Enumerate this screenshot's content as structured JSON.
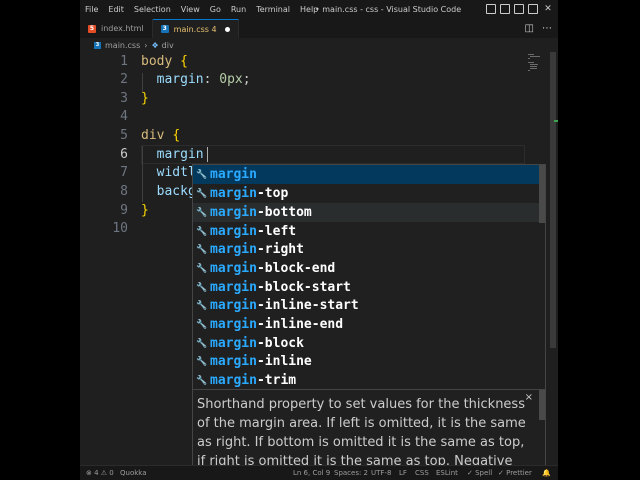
{
  "titlebar": {
    "menu": [
      "File",
      "Edit",
      "Selection",
      "View",
      "Go",
      "Run",
      "Terminal",
      "Help"
    ],
    "title": "• main.css - css - Visual Studio Code",
    "close_glyph": "✕"
  },
  "tabs": [
    {
      "label": "index.html",
      "type": "html"
    },
    {
      "label": "main.css 4",
      "type": "css",
      "modified": true
    }
  ],
  "tab_actions": {
    "split": "◫",
    "more": "⋯"
  },
  "breadcrumb": {
    "file": "main.css",
    "separator": "›",
    "symbol": "div"
  },
  "editor": {
    "line_numbers": [
      "1",
      "2",
      "3",
      "4",
      "5",
      "6",
      "7",
      "8",
      "9",
      "10"
    ],
    "current_line": "6",
    "code": {
      "l1_sel": "body",
      "l1_brace": "{",
      "l2_prop": "margin",
      "l2_colon": ":",
      "l2_val": "0px",
      "l2_semi": ";",
      "l3_brace": "}",
      "l5_sel": "div",
      "l5_brace": "{",
      "l6_prop": "margin",
      "l7_prop": "widtl",
      "l8_prop": "backg",
      "l9_brace": "}"
    }
  },
  "suggest": {
    "match": "margin",
    "icon": "🔧",
    "items": [
      {
        "rest": ""
      },
      {
        "rest": "-top"
      },
      {
        "rest": "-bottom"
      },
      {
        "rest": "-left"
      },
      {
        "rest": "-right"
      },
      {
        "rest": "-block-end"
      },
      {
        "rest": "-block-start"
      },
      {
        "rest": "-inline-start"
      },
      {
        "rest": "-inline-end"
      },
      {
        "rest": "-block"
      },
      {
        "rest": "-inline"
      },
      {
        "rest": "-trim"
      }
    ],
    "selected_index": 0
  },
  "details": {
    "text": "Shorthand property to set values for the thickness of the margin area. If left is omitted, it is the same as right. If bottom is omitted it is the same as top, if right is omitted it is the same as top. Negative values for",
    "close": "×"
  },
  "statusbar": {
    "problems": "⊗ 4 ⚠ 0",
    "quokka": "Quokka",
    "position": "Ln 6, Col 9",
    "spaces": "Spaces: 2",
    "encoding": "UTF-8",
    "eol": "LF",
    "language": "CSS",
    "eslint": "ESLint",
    "spell": "✓ Spell",
    "prettier": "✓ Prettier",
    "bell": "🔔"
  }
}
